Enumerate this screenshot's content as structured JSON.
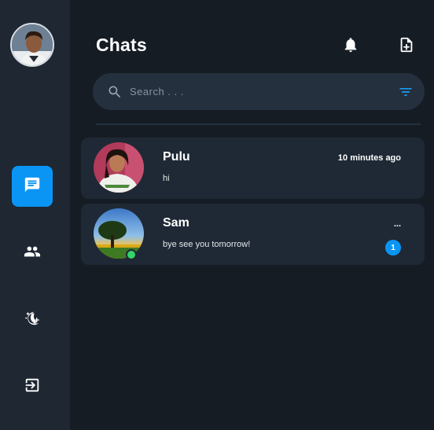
{
  "header": {
    "title": "Chats",
    "icons": [
      "bell-icon",
      "new-chat-icon"
    ]
  },
  "search": {
    "placeholder": "Search . . .",
    "value": "",
    "icons": [
      "search-icon",
      "filter-icon"
    ]
  },
  "sidebar": {
    "items": [
      {
        "name": "chats",
        "icon": "chat-bubble-icon",
        "active": true
      },
      {
        "name": "contacts",
        "icon": "people-icon",
        "active": false
      },
      {
        "name": "theme",
        "icon": "theme-toggle-icon",
        "active": false
      },
      {
        "name": "logout",
        "icon": "logout-icon",
        "active": false
      }
    ]
  },
  "chats": [
    {
      "name": "Pulu",
      "preview": "hi",
      "time": "10 minutes ago",
      "unread": "",
      "online": false
    },
    {
      "name": "Sam",
      "preview": "bye see you tomorrow!",
      "time": "...",
      "unread": "1",
      "online": true
    }
  ],
  "colors": {
    "accent": "#0a95f5",
    "background": "#161c24",
    "sidebar": "#1e2732",
    "card": "#1f2935",
    "online": "#33d46a"
  }
}
